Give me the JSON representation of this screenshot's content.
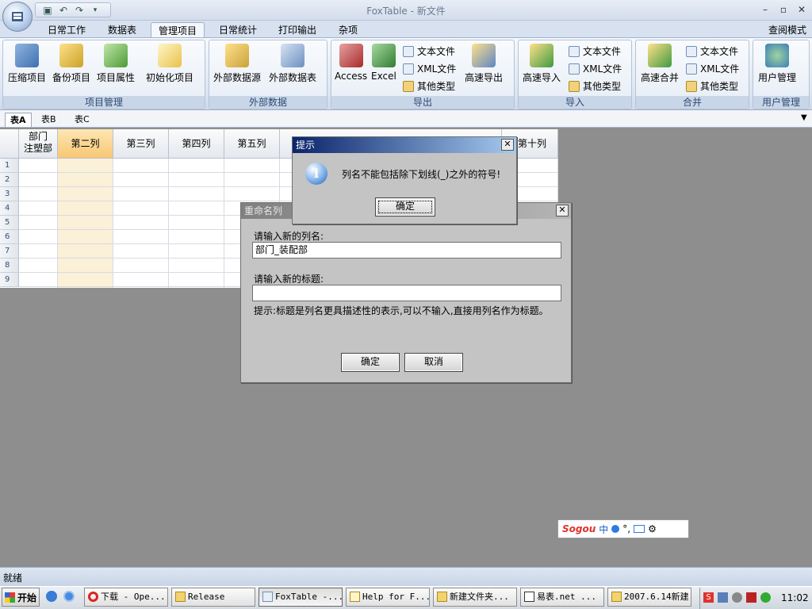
{
  "window": {
    "title": "FoxTable - 新文件",
    "read_mode": "查阅模式"
  },
  "menu_tabs": [
    {
      "label": "日常工作"
    },
    {
      "label": "数据表"
    },
    {
      "label": "管理项目",
      "active": true
    },
    {
      "label": "日常统计"
    },
    {
      "label": "打印输出"
    },
    {
      "label": "杂项"
    }
  ],
  "ribbon": {
    "project_mgmt": {
      "label": "项目管理",
      "buttons": [
        "压缩项目",
        "备份项目",
        "项目属性",
        "初始化项目"
      ]
    },
    "external_data": {
      "label": "外部数据",
      "buttons": [
        "外部数据源",
        "外部数据表"
      ]
    },
    "export": {
      "label": "导出",
      "access": "Access",
      "excel": "Excel",
      "text_file": "文本文件",
      "xml_file": "XML文件",
      "other_type": "其他类型",
      "fast_export": "高速导出"
    },
    "import": {
      "label": "导入",
      "fast_import": "高速导入",
      "text_file": "文本文件",
      "xml_file": "XML文件",
      "other_type": "其他类型"
    },
    "merge": {
      "label": "合并",
      "fast_merge": "高速合并",
      "text_file": "文本文件",
      "xml_file": "XML文件",
      "other_type": "其他类型"
    },
    "user_mgmt": {
      "label": "用户管理",
      "user_mgmt_button": "用户管理"
    }
  },
  "sheet_tabs": [
    {
      "label": "表A",
      "active": true
    },
    {
      "label": "表B"
    },
    {
      "label": "表C"
    }
  ],
  "grid": {
    "col1_top": "部门",
    "col1_bottom": "注塑部",
    "columns": [
      "第二列",
      "第三列",
      "第四列",
      "第五列"
    ],
    "last_column": "第十列",
    "rows": [
      "1",
      "2",
      "3",
      "4",
      "5",
      "6",
      "7",
      "8",
      "9"
    ]
  },
  "message_box": {
    "title": "提示",
    "message": "列名不能包括除下划线(_)之外的符号!",
    "ok": "确定"
  },
  "rename_dialog": {
    "title": "重命名列",
    "name_label": "请输入新的列名:",
    "name_value": "部门_装配部",
    "caption_label": "请输入新的标题:",
    "caption_value": "",
    "hint": "提示:标题是列名更具描述性的表示,可以不输入,直接用列名作为标题。",
    "ok": "确定",
    "cancel": "取消"
  },
  "status": {
    "text": "就绪"
  },
  "taskbar": {
    "start": "开始",
    "items": [
      "下载 - Ope...",
      "Release",
      "FoxTable -...",
      "Help for F...",
      "新建文件夹...",
      "易表.net  ...",
      "2007.6.14新建"
    ],
    "clock": "11:02"
  },
  "ime": {
    "logo": "Sogou",
    "mode": "中",
    "punct": "°,"
  },
  "colors": {
    "accent": "#0a246a",
    "ribbon_bg": "#dfe7f2",
    "dialog_bg": "#c4c4c4",
    "workspace": "#8e8e8e"
  }
}
